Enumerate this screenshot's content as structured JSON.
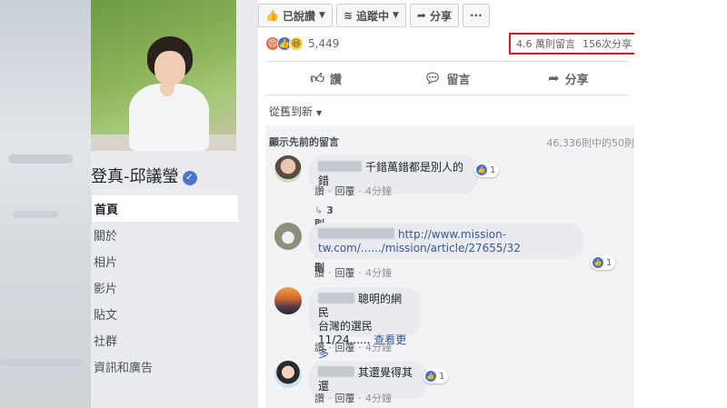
{
  "page": {
    "name": "登真-邱議瑩",
    "verified_icon": "verified-check-icon"
  },
  "nav": {
    "items": [
      {
        "label": "首頁",
        "active": true
      },
      {
        "label": "關於"
      },
      {
        "label": "相片"
      },
      {
        "label": "影片"
      },
      {
        "label": "貼文"
      },
      {
        "label": "社群"
      },
      {
        "label": "資訊和廣告"
      }
    ]
  },
  "toolbar": {
    "liked_label": "已說讚",
    "following_label": "追蹤中",
    "share_label": "分享",
    "more_label": "···"
  },
  "post": {
    "reaction_count": "5,449",
    "comments_stat": "4.6 萬則留言",
    "shares_stat": "156次分享",
    "actions": {
      "like": "讚",
      "comment": "留言",
      "share": "分享"
    },
    "sort_label": "從舊到新",
    "previous_comments": "顯示先前的留言",
    "comments_counter": "46,336則中的50則"
  },
  "comments": [
    {
      "text": "千錯萬錯都是別人的錯",
      "likes": "1",
      "reply_label": "讚",
      "respond_label": "回覆",
      "time": "4分鐘",
      "replies_link": "3則回覆",
      "replies_tail": "刪"
    },
    {
      "text_line1": "http://www.mission-",
      "text_line2": "tw.com/....../mission/article/27655/32",
      "likes": "1",
      "reply_label": "讚",
      "respond_label": "回覆",
      "time": "4分鐘"
    },
    {
      "text_line1": "聰明的網民",
      "text_line2": "台灣的選民",
      "text_line3": "11/24......",
      "see_more": "查看更多",
      "reply_label": "讚",
      "respond_label": "回覆",
      "time": "4分鐘"
    },
    {
      "text": "其還覺得其還",
      "likes": "1",
      "reply_label": "讚",
      "respond_label": "回覆",
      "time": "4分鐘"
    }
  ],
  "colors": {
    "highlight_box": "#d7191c",
    "facebook_blue": "#4a76c9",
    "link_blue": "#385898"
  }
}
